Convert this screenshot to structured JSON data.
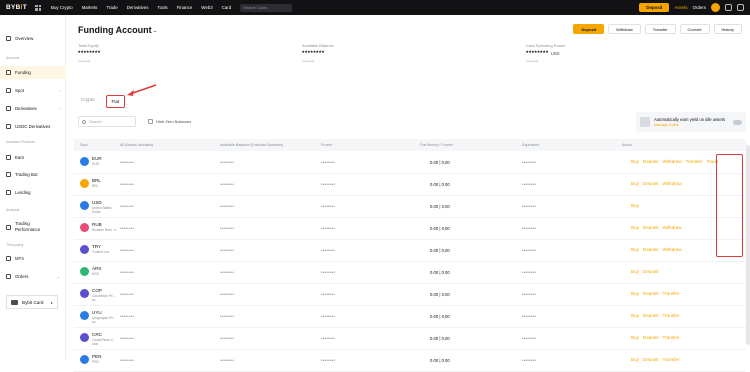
{
  "topbar": {
    "logo_main": "BYB",
    "logo_accent": "I",
    "logo_tail": "T",
    "nav": [
      "Buy Crypto",
      "Markets",
      "Trade",
      "Derivatives",
      "Tools",
      "Finance",
      "Web3",
      "Card"
    ],
    "search_placeholder": "Search Coins",
    "deposit_label": "Deposit",
    "assets_label": "Assets",
    "orders_label": "Orders"
  },
  "sidebar": {
    "overview": "Overview",
    "account_group": "Account",
    "funding": "Funding",
    "spot": "Spot",
    "derivatives": "Derivatives",
    "usdc_derivatives": "USDC Derivatives",
    "invested_group": "Invested Products",
    "earn": "Earn",
    "trading_bot": "Trading Bot",
    "lending": "Lending",
    "analysis_group": "Analysis",
    "trading_performance": "Trading Performance",
    "third_party_group": "Third-party",
    "mt4": "MT4",
    "orders": "Orders",
    "bybit_card": "Bybit Card"
  },
  "page": {
    "title": "Funding Account",
    "title_icon": "eye-icon",
    "buttons": [
      "Deposit",
      "Withdraw",
      "Transfer",
      "Convert",
      "History"
    ]
  },
  "stats": {
    "total_equity_label": "Total Equity",
    "total_equity_value": "********",
    "total_equity_sub": "********",
    "available_label": "Available Balance",
    "available_value": "********",
    "available_sub": "********",
    "card_power_label": "Card Spending Power",
    "card_power_value": "********",
    "card_power_unit": "USD",
    "card_power_sub": "********"
  },
  "tabs": {
    "crypto": "Crypto",
    "fiat": "Fiat"
  },
  "search": {
    "placeholder": "Search",
    "hide_zero": "Hide Zero Balances"
  },
  "earn_banner": {
    "line1": "Automatically earn yield on idle assets",
    "line2": "Manage Coins",
    "toggle_label": "On"
  },
  "table": {
    "headers": [
      "Spot",
      "All (Bonus Included)",
      "Available Balance (Excludes Bonuses)",
      "Frozen",
      "Fiat Money / Frozen",
      "Equivalent",
      "Action"
    ],
    "rows": [
      {
        "code": "EUR",
        "name": "EUR",
        "color": "#2b7be4",
        "all": "********",
        "avail": "********",
        "frozen": "********",
        "fiat": "0.00 | 0.00",
        "equiv": "********",
        "actions": [
          "Buy",
          "Deposit",
          "Withdraw",
          "Transfer",
          "Trade"
        ]
      },
      {
        "code": "BRL",
        "name": "BRL",
        "color": "#f7a600",
        "all": "********",
        "avail": "********",
        "frozen": "********",
        "fiat": "0.00 | 0.00",
        "equiv": "********",
        "actions": [
          "Buy",
          "Deposit",
          "Withdraw"
        ]
      },
      {
        "code": "USD",
        "name": "United States Dollar",
        "color": "#2b7be4",
        "all": "********",
        "avail": "********",
        "frozen": "********",
        "fiat": "0.00 | 0.00",
        "equiv": "********",
        "actions": [
          "Buy"
        ]
      },
      {
        "code": "RUB",
        "name": "Russian Rubl.. e",
        "color": "#e84a7a",
        "all": "********",
        "avail": "********",
        "frozen": "********",
        "fiat": "0.00 | 0.00",
        "equiv": "********",
        "actions": [
          "Buy",
          "Deposit",
          "Withdraw"
        ]
      },
      {
        "code": "TRY",
        "name": "Turkish Lira",
        "color": "#5a4fcf",
        "all": "********",
        "avail": "********",
        "frozen": "********",
        "fiat": "0.00 | 0.00",
        "equiv": "********",
        "actions": [
          "Buy",
          "Deposit",
          "Withdraw"
        ]
      },
      {
        "code": "ARS",
        "name": "ARS",
        "color": "#2bb673",
        "all": "********",
        "avail": "********",
        "frozen": "********",
        "fiat": "0.00 | 0.00",
        "equiv": "********",
        "actions": [
          "Buy",
          "Deposit"
        ]
      },
      {
        "code": "COP",
        "name": "Colombian Pe... so",
        "color": "#5a4fcf",
        "all": "********",
        "avail": "********",
        "frozen": "********",
        "fiat": "0.00 | 0.00",
        "equiv": "********",
        "actions": [
          "Buy",
          "Deposit",
          "Transfer"
        ]
      },
      {
        "code": "UYU",
        "name": "Uruguayan Pe... so",
        "color": "#2b7be4",
        "all": "********",
        "avail": "********",
        "frozen": "********",
        "fiat": "0.00 | 0.00",
        "equiv": "********",
        "actions": [
          "Buy",
          "Deposit",
          "Transfer"
        ]
      },
      {
        "code": "CRC",
        "name": "Costa Rican C... olón",
        "color": "#5a4fcf",
        "all": "********",
        "avail": "********",
        "frozen": "********",
        "fiat": "0.00 | 0.00",
        "equiv": "********",
        "actions": [
          "Buy",
          "Deposit",
          "Transfer"
        ]
      },
      {
        "code": "PEN",
        "name": "PEN",
        "color": "#2b7be4",
        "all": "********",
        "avail": "********",
        "frozen": "********",
        "fiat": "0.00 | 0.00",
        "equiv": "********",
        "actions": [
          "Buy",
          "Deposit",
          "Transfer"
        ]
      }
    ]
  }
}
